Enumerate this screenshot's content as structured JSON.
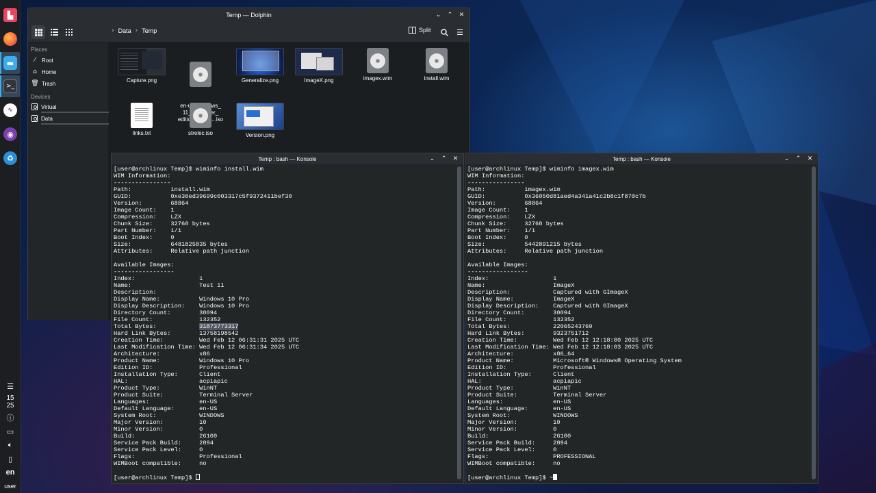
{
  "panel": {
    "clock": {
      "hour": "15",
      "minute": "25"
    },
    "keyboard_layout": "en",
    "user": "user",
    "launchers": [
      {
        "name": "app-launcher-icon",
        "color": "#e94560"
      },
      {
        "name": "firefox-icon",
        "color": "#ff7139"
      },
      {
        "name": "dolphin-icon",
        "color": "#3daee9"
      },
      {
        "name": "konsole-icon",
        "color": "#31363b"
      },
      {
        "name": "audio-app-icon",
        "color": "#6d4aa0"
      },
      {
        "name": "chat-app-icon",
        "color": "#7a3fb0"
      },
      {
        "name": "recycle-app-icon",
        "color": "#2a8fd8"
      }
    ]
  },
  "dolphin": {
    "title": "Temp — Dolphin",
    "breadcrumb": [
      "Data",
      "Temp"
    ],
    "split_label": "Split",
    "places_heading": "Places",
    "places": [
      "Root",
      "Home",
      "Trash"
    ],
    "devices_heading": "Devices",
    "devices": [
      "Virtual",
      "Data"
    ],
    "device_usage": [
      0.95,
      0.95
    ],
    "files": [
      {
        "name": "Capture.png",
        "type": "shot",
        "style": "dark"
      },
      {
        "name": "en-us_windows_\n11_consumer_\neditions_vers....iso",
        "type": "disc"
      },
      {
        "name": "Generalize.png",
        "type": "shot",
        "style": "blue"
      },
      {
        "name": "ImageX.png",
        "type": "shot",
        "style": "light"
      },
      {
        "name": "imagex.wim",
        "type": "disc"
      },
      {
        "name": "install.wim",
        "type": "disc"
      },
      {
        "name": "links.txt",
        "type": "txt"
      },
      {
        "name": "strelec.iso",
        "type": "disc"
      },
      {
        "name": "Version.png",
        "type": "shot",
        "style": "version"
      }
    ]
  },
  "konsole_left": {
    "title": "Temp : bash — Konsole",
    "lines": [
      "[user@archlinux Temp]$ wiminfo install.wim",
      "WIM Information:",
      "----------------",
      "Path:           install.wim",
      "GUID:           0xe30ed39699c003317c5f9372411bef30",
      "Version:        68864",
      "Image Count:    1",
      "Compression:    LZX",
      "Chunk Size:     32768 bytes",
      "Part Number:    1/1",
      "Boot Index:     0",
      "Size:           6481825835 bytes",
      "Attributes:     Relative path junction",
      "",
      "Available Images:",
      "-----------------",
      "Index:                  1",
      "Name:                   Test 11",
      "Description:",
      "Display Name:           Windows 10 Pro",
      "Display Description:    Windows 10 Pro",
      "Directory Count:        30094",
      "File Count:             132352",
      "Total Bytes:            31873773317",
      "Hard Link Bytes:        13758198542",
      "Creation Time:          Wed Feb 12 06:31:31 2025 UTC",
      "Last Modification Time: Wed Feb 12 06:31:34 2025 UTC",
      "Architecture:           x86",
      "Product Name:           Windows 10 Pro",
      "Edition ID:             Professional",
      "Installation Type:      Client",
      "HAL:                    acpiapic",
      "Product Type:           WinNT",
      "Product Suite:          Terminal Server",
      "Languages:              en-US",
      "Default Language:       en-US",
      "System Root:            WINDOWS",
      "Major Version:          10",
      "Minor Version:          0",
      "Build:                  26100",
      "Service Pack Build:     2894",
      "Service Pack Level:     0",
      "Flags:                  Professional",
      "WIMBoot compatible:     no",
      "",
      "[user@archlinux Temp]$ "
    ],
    "selection": {
      "line": 23,
      "text": "31873773317"
    }
  },
  "konsole_right": {
    "title": "Temp : bash — Konsole",
    "lines": [
      "[user@archlinux Temp]$ wiminfo imagex.wim",
      "WIM Information:",
      "----------------",
      "Path:           imagex.wim",
      "GUID:           0x36050d81aed4a341a41c2b8c1f870c7b",
      "Version:        68864",
      "Image Count:    1",
      "Compression:    LZX",
      "Chunk Size:     32768 bytes",
      "Part Number:    1/1",
      "Boot Index:     0",
      "Size:           5442891215 bytes",
      "Attributes:     Relative path junction",
      "",
      "Available Images:",
      "-----------------",
      "Index:                  1",
      "Name:                   ImageX",
      "Description:            Captured with GImageX",
      "Display Name:           ImageX",
      "Display Description:    Captured with GImageX",
      "Directory Count:        30094",
      "File Count:             132352",
      "Total Bytes:            22065243769",
      "Hard Link Bytes:        9323751712",
      "Creation Time:          Wed Feb 12 12:18:00 2025 UTC",
      "Last Modification Time: Wed Feb 12 12:18:03 2025 UTC",
      "Architecture:           x86_64",
      "Product Name:           Microsoft® Windows® Operating System",
      "Edition ID:             Professional",
      "Installation Type:      Client",
      "HAL:                    acpiapic",
      "Product Type:           WinNT",
      "Product Suite:          Terminal Server",
      "Languages:              en-US",
      "Default Language:       en-US",
      "System Root:            WINDOWS",
      "Major Version:          10",
      "Minor Version:          0",
      "Build:                  26100",
      "Service Pack Build:     2894",
      "Service Pack Level:     0",
      "Flags:                  PROFESSIONAL",
      "WIMBoot compatible:     no",
      "",
      "[user@archlinux Temp]$ ~"
    ]
  }
}
